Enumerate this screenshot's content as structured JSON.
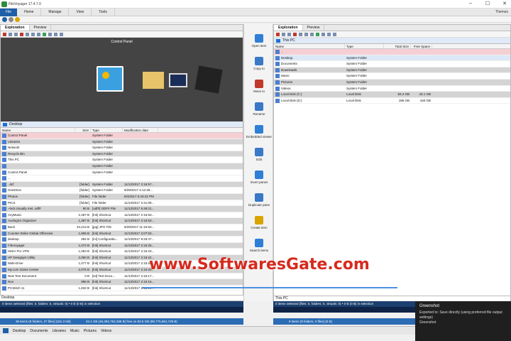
{
  "window": {
    "title": "FileVoyager 17.4.7.0"
  },
  "ribbon": {
    "file": "File",
    "tabs": [
      "Home",
      "Manage",
      "View",
      "Tools"
    ],
    "themes": "Themes"
  },
  "left": {
    "tabs": [
      "Exploration",
      "Preview"
    ],
    "preview_title": "Control Panel",
    "path": "Desktop",
    "columns": [
      "Name",
      "Size",
      "Type",
      "Modification date"
    ],
    "rows": [
      {
        "name": "Control Panel",
        "size": "",
        "type": "System Folder",
        "date": ""
      },
      {
        "name": "Libraries",
        "size": "",
        "type": "System Folder",
        "date": ""
      },
      {
        "name": "Network",
        "size": "",
        "type": "System Folder",
        "date": ""
      },
      {
        "name": "Recycle Bin",
        "size": "",
        "type": "System Folder",
        "date": ""
      },
      {
        "name": "This PC",
        "size": "",
        "type": "System Folder",
        "date": ""
      },
      {
        "name": "",
        "size": "",
        "type": "System Folder",
        "date": ""
      },
      {
        "name": "Control Panel",
        "size": "",
        "type": "System Folder",
        "date": ""
      },
      {
        "name": "...",
        "size": "",
        "type": "",
        "date": ""
      },
      {
        "name": "..dcf",
        "size": "[folder]",
        "type": "System Folder",
        "date": "11/13/2017 2:16:57..."
      },
      {
        "name": "OneDrive",
        "size": "[folder]",
        "type": "System Folder",
        "date": "8/29/2017 2:12:28..."
      },
      {
        "name": "Photos",
        "size": "[folder]",
        "type": "File folder",
        "date": "8/4/2017 5:43:42 PM"
      },
      {
        "name": "PICS",
        "size": "[folder]",
        "type": "File folder",
        "date": "11/13/2017 2:41:09..."
      },
      {
        "name": "~lock.Usually met..odf#",
        "size": "90 B",
        "type": "[odf#] ODF# File",
        "date": "11/13/2017 5:49:21..."
      },
      {
        "name": "AnyMusic",
        "size": "2,467 B",
        "type": "[lnk] Shortcut",
        "date": "11/13/2017 2:16:53..."
      },
      {
        "name": "Auslogics Organizer",
        "size": "1,387 B",
        "type": "[lnk] Shortcut",
        "date": "11/13/2017 2:16:53..."
      },
      {
        "name": "Back",
        "size": "34,213 B",
        "type": "[jpg] JPG File",
        "date": "8/29/2017 11:16:53..."
      },
      {
        "name": "Counter-Strike Global Offensive",
        "size": "1,906 B",
        "type": "[lnk] Shortcut",
        "date": "11/13/2017 2:07:53..."
      },
      {
        "name": "desktop",
        "size": "282 B",
        "type": "[ini] Configuratio...",
        "date": "11/13/2017 9:33:47..."
      },
      {
        "name": "FileVoyager",
        "size": "1,072 B",
        "type": "[lnk] Shortcut",
        "date": "11/13/2017 2:15:25..."
      },
      {
        "name": "HMA! Pro VPN",
        "size": "1,053 B",
        "type": "[lnk] Shortcut",
        "date": "11/13/2017 2:15:23..."
      },
      {
        "name": "HP Designjet Utility",
        "size": "2,060 B",
        "type": "[lnk] Shortcut",
        "date": "11/13/2017 2:15:22..."
      },
      {
        "name": "Multi-Drive",
        "size": "1,077 B",
        "type": "[lnk] Shortcut",
        "date": "11/13/2017 2:15:20..."
      },
      {
        "name": "My.com Game Center",
        "size": "2,075 B",
        "type": "[lnk] Shortcut",
        "date": "11/13/2017 2:15:20..."
      },
      {
        "name": "New Text Document",
        "size": "0 B",
        "type": "[txt] Text Docu...",
        "date": "11/13/2017 2:15:17..."
      },
      {
        "name": "Nox",
        "size": "996 B",
        "type": "[lnk] Shortcut",
        "date": "11/13/2017 2:15:16..."
      },
      {
        "name": "PCStitch 11",
        "size": "1,832 B",
        "type": "[lnk] Shortcut",
        "date": "11/13/2017 2:15:14..."
      }
    ],
    "pathbox": "Desktop",
    "status": "0 items selected (files: 0, folders: 0, virtuals: 0) • 0 B (0 B) in selection",
    "disk": "36 items (9 folders, 27 files) [181.3 KB]",
    "disk2": "43.1 GB (46,392,752,288 B) free on 83.5 GB (89,775,591,728 B)"
  },
  "right": {
    "tabs": [
      "Exploration",
      "Preview"
    ],
    "path": "This PC",
    "columns": [
      "Name",
      "Type",
      "Total Size",
      "Free Space"
    ],
    "rows": [
      {
        "name": "..",
        "type": "",
        "total": "",
        "free": ""
      },
      {
        "name": "Desktop",
        "type": "System Folder",
        "total": "",
        "free": ""
      },
      {
        "name": "Documents",
        "type": "System Folder",
        "total": "",
        "free": ""
      },
      {
        "name": "Downloads",
        "type": "System Folder",
        "total": "",
        "free": ""
      },
      {
        "name": "Music",
        "type": "System Folder",
        "total": "",
        "free": ""
      },
      {
        "name": "Pictures",
        "type": "System Folder",
        "total": "",
        "free": ""
      },
      {
        "name": "Videos",
        "type": "System Folder",
        "total": "",
        "free": ""
      },
      {
        "name": "Local Disk (C:)",
        "type": "Local Disk",
        "total": "83.4 GB",
        "free": "43.1 GB"
      },
      {
        "name": "Local Disk (D:)",
        "type": "Local Disk",
        "total": "186 GB",
        "free": "160 GB"
      }
    ],
    "pathbox": "This PC",
    "status": "0 items selected (files: 0, folders: 0, virtuals: 0) • 0 B (0 B) in selection",
    "disk": "9 items (9 folders, 0 files) [0 B]"
  },
  "actions": [
    "Open item",
    "Copy to",
    "Move to",
    "Rename",
    "Embedded viewer",
    "Edit",
    "Invert panes",
    "Duplicate pane",
    "Create item",
    "Search items"
  ],
  "bottom": [
    "Desktop",
    "Documents",
    "Libraries",
    "Music",
    "Pictures",
    "Videos"
  ],
  "notification": {
    "title": "Greenshot",
    "body": "Exported to: Save directly (using preferred file output settings)",
    "footer": "Greenshot"
  },
  "watermark": "www.SoftwaresGate.com"
}
